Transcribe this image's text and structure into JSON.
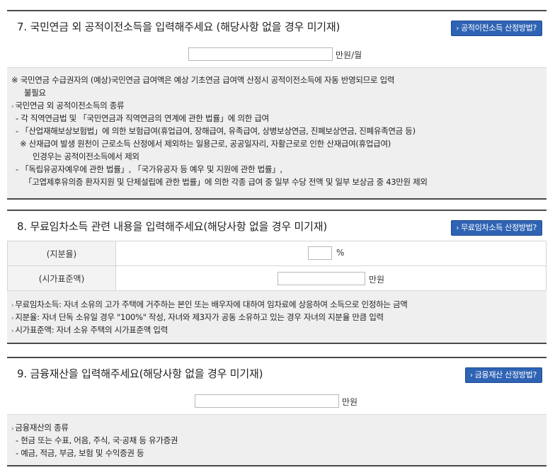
{
  "s7": {
    "title": "7. 국민연금 외 공적이전소득을 입력해주세요 (해당사항 없을 경우 미기재)",
    "button": "공적이전소득 산정방법?",
    "input_value": "",
    "unit": "만원/월",
    "notes": [
      "※ 국민연금 수급권자의 (예상)국민연금 급여액은 예상 기초연금 급여액 산정시 공적이전소득에 자동 반영되므로 입력",
      "불필요",
      "국민연금 외 공적이전소득의 종류",
      "- 각 직역연금법 및 「국민연금과 직역연금의 연계에 관한 법률」에 의한 급여",
      "- 「산업재해보상보험법」에 의한 보험급여(휴업급여, 장해급여, 유족급여, 상병보상연금, 진폐보상연금, 진폐유족연금 등)",
      "※ 산재급여 발생 원천이 근로소득 산정에서 제외하는 일용근로, 공공일자리, 자활근로로 인한 산재급여(휴업급여)",
      "인경우는 공적이전소득에서 제외",
      "- 「독립유공자예우에 관한 법률」, 「국가유공자 등 예우 및 지원에 관한 법률」,",
      "「고엽제후유의증 환자지원 및 단체설립에 관한 법률」에 의한 각종 급여 중 일부 수당 전액 및 일부 보상금 중 43만원 제외"
    ]
  },
  "s8": {
    "title": "8. 무료임차소득 관련 내용을 입력해주세요(해당사항 없을 경우 미기재)",
    "button": "무료임차소득 산정방법?",
    "share_label": "(지분율)",
    "share_value": "",
    "share_unit": "%",
    "price_label": "(시가표준액)",
    "price_value": "",
    "price_unit": "만원",
    "notes": [
      "무료임차소득: 자녀 소유의 고가 주택에 거주하는 본인 또는 배우자에 대하여 임차료에 상응하여 소득으로 인정하는 금액",
      "지분율: 자녀 단독 소유일 경우 \"100%\" 작성, 자녀와 제3자가 공동 소유하고 있는 경우 자녀의 지분율 만큼 입력",
      "시가표준액: 자녀 소유 주택의 시가표준액 입력"
    ]
  },
  "s9": {
    "title": "9. 금융재산을 입력해주세요(해당사항 없을 경우 미기재)",
    "button": "금융재산 산정방법?",
    "input_value": "",
    "unit": "만원",
    "notes": [
      "금융재산의 종류",
      "- 현금 또는 수표, 어음, 주식, 국·공채 등 유가증권",
      "- 예금, 적금, 부금, 보험 및 수익증권 등"
    ]
  }
}
